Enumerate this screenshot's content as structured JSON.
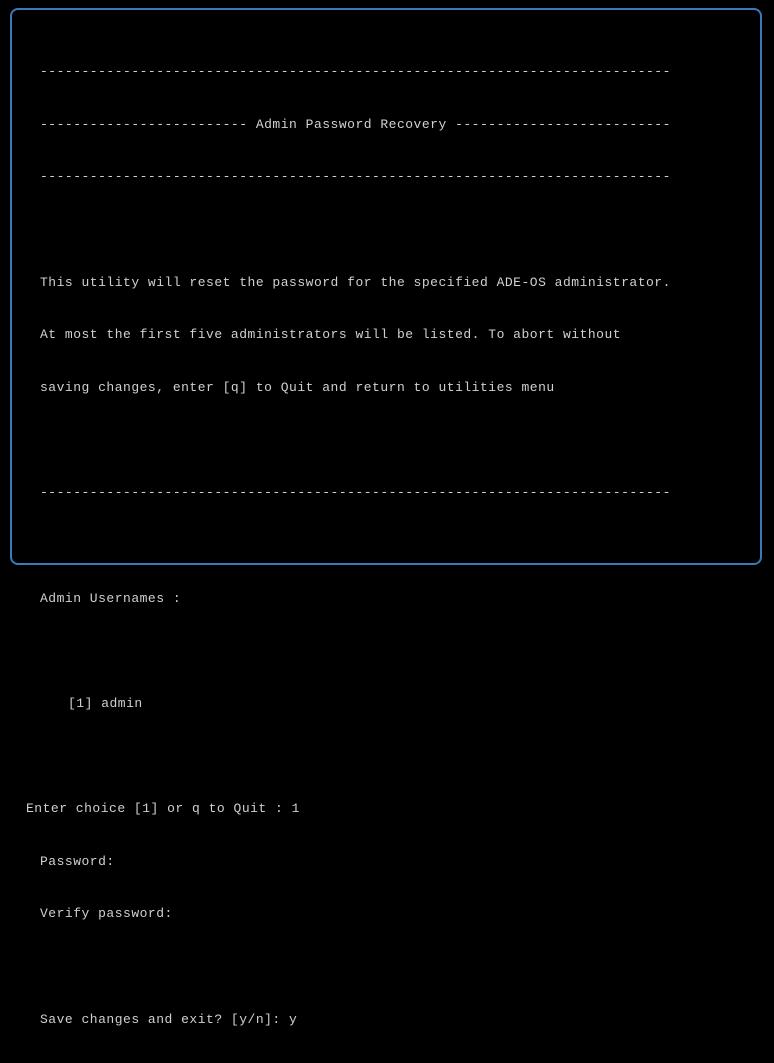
{
  "header": {
    "rule_top": "----------------------------------------------------------------------------",
    "title_line": "------------------------- Admin Password Recovery --------------------------",
    "rule_bottom": "----------------------------------------------------------------------------"
  },
  "description": {
    "line1": "This utility will reset the password for the specified ADE-OS administrator.",
    "line2": "At most the first five administrators will be listed. To abort without",
    "line3": "saving changes, enter [q] to Quit and return to utilities menu"
  },
  "separator": "----------------------------------------------------------------------------",
  "usernames": {
    "label": "Admin Usernames :",
    "items": [
      "[1] admin"
    ]
  },
  "prompts": {
    "choice_label": "Enter choice [1] or q to Quit : ",
    "choice_value": "1",
    "password_label": "Password:",
    "verify_label": "Verify password:",
    "save_label": "Save changes and exit? [y/n]: ",
    "save_value": "y"
  }
}
